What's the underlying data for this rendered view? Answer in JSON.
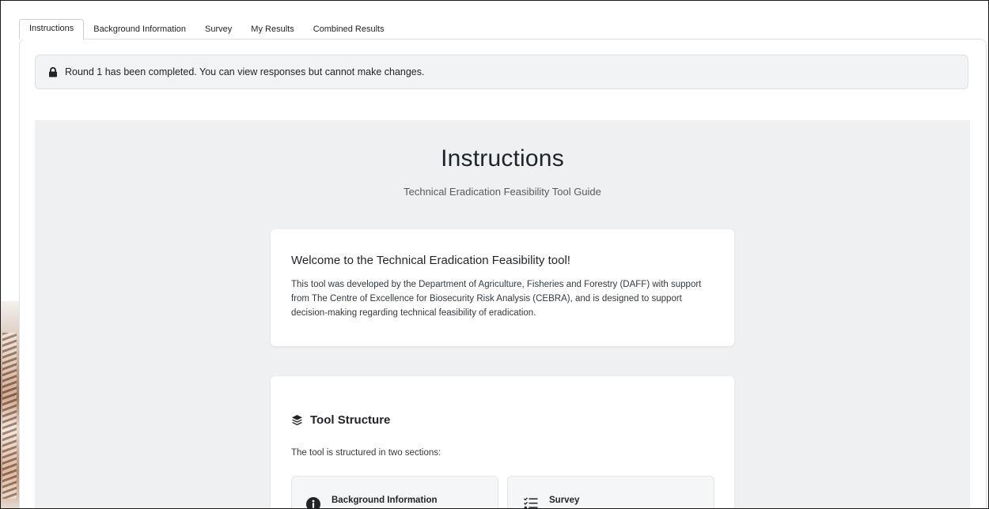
{
  "tabs": [
    {
      "label": "Instructions",
      "active": true
    },
    {
      "label": "Background Information",
      "active": false
    },
    {
      "label": "Survey",
      "active": false
    },
    {
      "label": "My Results",
      "active": false
    },
    {
      "label": "Combined Results",
      "active": false
    }
  ],
  "alert": {
    "icon": "lock-icon",
    "text": "Round 1 has been completed. You can view responses but cannot make changes."
  },
  "page": {
    "title": "Instructions",
    "subtitle": "Technical Eradication Feasibility Tool Guide"
  },
  "welcome_card": {
    "heading": "Welcome to the Technical Eradication Feasibility tool!",
    "body": "This tool was developed by the Department of Agriculture, Fisheries and Forestry (DAFF) with support from The Centre of Excellence for Biosecurity Risk Analysis (CEBRA), and is designed to support decision-making regarding technical feasibility of eradication."
  },
  "structure_card": {
    "icon": "layers-icon",
    "heading": "Tool Structure",
    "intro": "The tool is structured in two sections:",
    "sections": [
      {
        "icon": "info-circle-icon",
        "label": "Background Information"
      },
      {
        "icon": "list-check-icon",
        "label": "Survey"
      }
    ]
  },
  "colors": {
    "content_background": "#eef0f2",
    "alert_background": "#f1f3f5",
    "card_background": "#ffffff",
    "text": "#212529"
  }
}
